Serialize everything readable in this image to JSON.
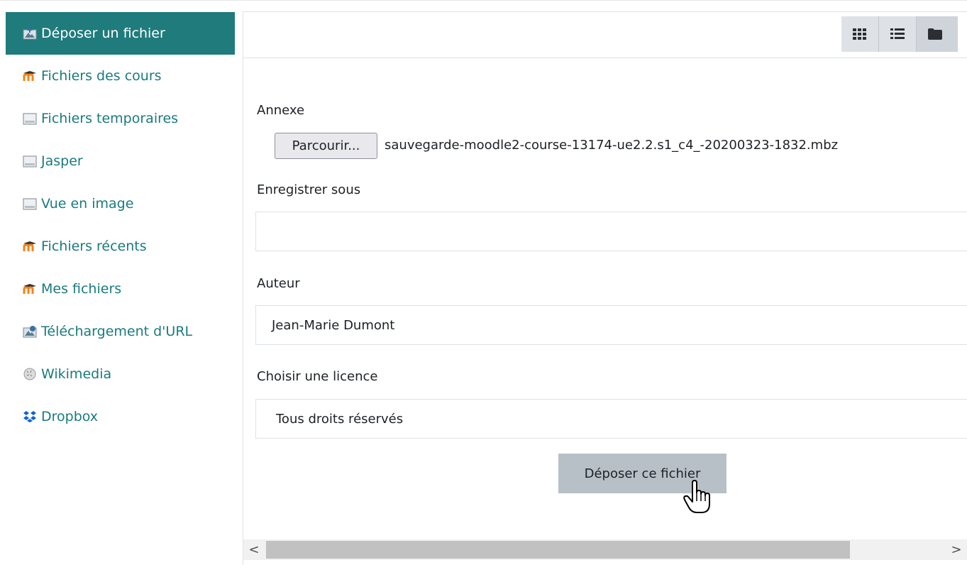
{
  "sidebar": {
    "items": [
      {
        "label": "Déposer un fichier",
        "icon": "upload-icon",
        "active": true
      },
      {
        "label": "Fichiers des cours",
        "icon": "moodle-icon"
      },
      {
        "label": "Fichiers temporaires",
        "icon": "repository-icon"
      },
      {
        "label": "Jasper",
        "icon": "repository-icon"
      },
      {
        "label": "Vue en image",
        "icon": "repository-icon"
      },
      {
        "label": "Fichiers récents",
        "icon": "moodle-icon"
      },
      {
        "label": "Mes fichiers",
        "icon": "moodle-icon"
      },
      {
        "label": "Téléchargement d'URL",
        "icon": "url-download-icon"
      },
      {
        "label": "Wikimedia",
        "icon": "wikimedia-icon"
      },
      {
        "label": "Dropbox",
        "icon": "dropbox-icon"
      }
    ]
  },
  "toolbar": {
    "views": [
      "grid-view-icon",
      "list-view-icon",
      "folder-view-icon"
    ]
  },
  "form": {
    "attachment_label": "Annexe",
    "browse_label": "Parcourir...",
    "file_name": "sauvegarde-moodle2-course-13174-ue2.2.s1_c4_-20200323-1832.mbz",
    "save_as_label": "Enregistrer sous",
    "save_as_value": "",
    "author_label": "Auteur",
    "author_value": "Jean-Marie Dumont",
    "license_label": "Choisir une licence",
    "license_value": "Tous droits réservés",
    "submit_label": "Déposer ce fichier"
  },
  "scrollbar": {
    "left_arrow": "<",
    "right_arrow": ">"
  },
  "colors": {
    "accent": "#1f7b7c",
    "link": "#1a7a7e",
    "moodle_orange": "#f98012"
  }
}
